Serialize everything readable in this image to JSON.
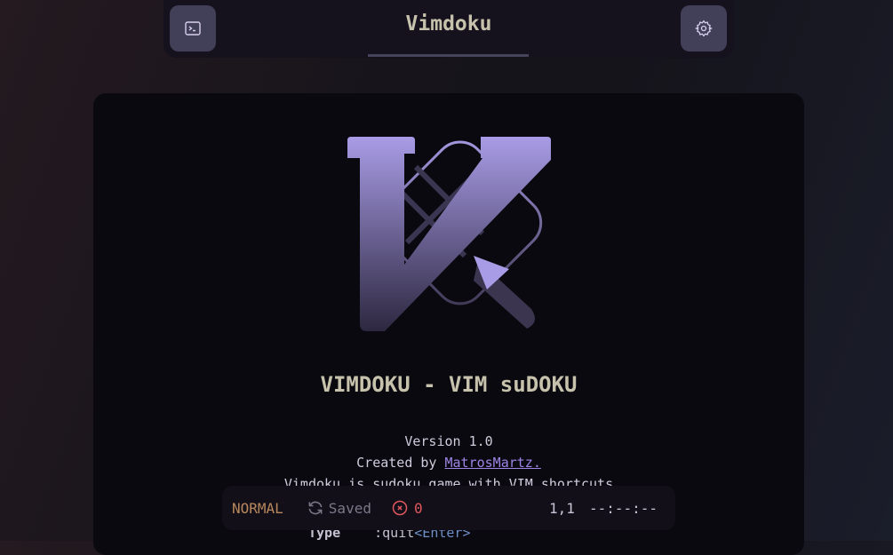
{
  "header": {
    "title": "Vimdoku",
    "left_icon": "terminal-icon",
    "right_icon": "gear-icon"
  },
  "main": {
    "heading": "VIMDOKU - VIM suDOKU",
    "version": "Version 1.0",
    "created_by": "Created by",
    "author": "MatrosMartz.",
    "description": "Vimdoku is sudoku game with VIM shortcuts",
    "type_label": "Type",
    "command": ":quit",
    "command_key": "<Enter>"
  },
  "status": {
    "mode": "NORMAL",
    "saved": "Saved",
    "errors": "0",
    "position": "1,1",
    "timer": "--:--:--"
  },
  "colors": {
    "accent": "#9d85e6",
    "mode": "#b7875c",
    "error": "#e0575e"
  }
}
